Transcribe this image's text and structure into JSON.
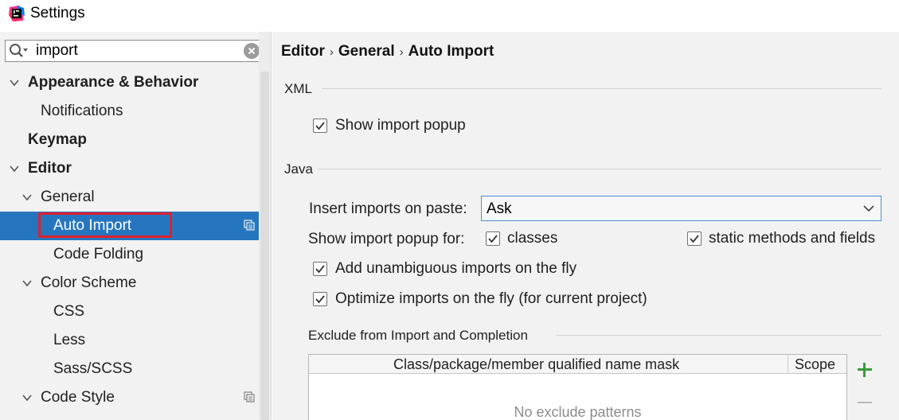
{
  "window": {
    "title": "Settings",
    "app_icon": "intellij-icon"
  },
  "search": {
    "value": "import",
    "search_icon": "search-icon",
    "clear_icon": "clear-icon"
  },
  "sidebar": {
    "items": [
      {
        "label": "Appearance & Behavior",
        "bold": true,
        "expanded": true
      },
      {
        "label": "Notifications"
      },
      {
        "label": "Keymap",
        "bold": true
      },
      {
        "label": "Editor",
        "bold": true,
        "expanded": true
      },
      {
        "label": "General",
        "expanded": true
      },
      {
        "label": "Auto Import",
        "selected": true
      },
      {
        "label": "Code Folding"
      },
      {
        "label": "Color Scheme",
        "expanded": true
      },
      {
        "label": "CSS"
      },
      {
        "label": "Less"
      },
      {
        "label": "Sass/SCSS"
      },
      {
        "label": "Code Style",
        "expanded": true
      }
    ]
  },
  "breadcrumb": {
    "parts": [
      "Editor",
      "General",
      "Auto Import"
    ],
    "separator": "›"
  },
  "xml": {
    "section_title": "XML",
    "show_import_popup": {
      "label": "Show import popup",
      "checked": true
    }
  },
  "java": {
    "section_title": "Java",
    "insert_on_paste": {
      "label": "Insert imports on paste:",
      "value": "Ask"
    },
    "show_popup_for": {
      "label": "Show import popup for:",
      "classes": {
        "label": "classes",
        "checked": true
      },
      "static_methods": {
        "label": "static methods and fields",
        "checked": true
      }
    },
    "add_unambiguous": {
      "label": "Add unambiguous imports on the fly",
      "checked": true
    },
    "optimize_imports": {
      "label": "Optimize imports on the fly (for current project)",
      "checked": true
    }
  },
  "exclude": {
    "section_title": "Exclude from Import and Completion",
    "columns": [
      "Class/package/member qualified name mask",
      "Scope"
    ],
    "empty_text": "No exclude patterns",
    "add_icon": "plus-icon",
    "remove_icon": "minus-icon"
  },
  "colors": {
    "selection": "#2675bf",
    "highlight": "#e0202c",
    "add": "#3a9a3a"
  }
}
